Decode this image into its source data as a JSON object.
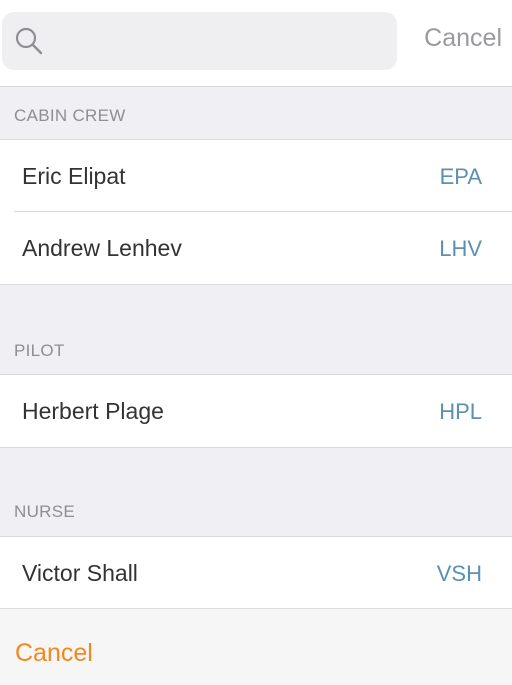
{
  "search": {
    "placeholder": "",
    "cancel_label": "Cancel",
    "icon": "search-icon"
  },
  "sections": [
    {
      "title": "CABIN CREW",
      "rows": [
        {
          "name": "Eric Elipat",
          "code": "EPA"
        },
        {
          "name": "Andrew Lenhev",
          "code": "LHV"
        }
      ]
    },
    {
      "title": "PILOT",
      "rows": [
        {
          "name": "Herbert Plage",
          "code": "HPL"
        }
      ]
    },
    {
      "title": "NURSE",
      "rows": [
        {
          "name": "Victor Shall",
          "code": "VSH"
        }
      ]
    }
  ],
  "footer": {
    "cancel_label": "Cancel"
  },
  "colors": {
    "accent": "#f5871f",
    "code_text": "#5b8fb3",
    "background": "#efeff4"
  }
}
